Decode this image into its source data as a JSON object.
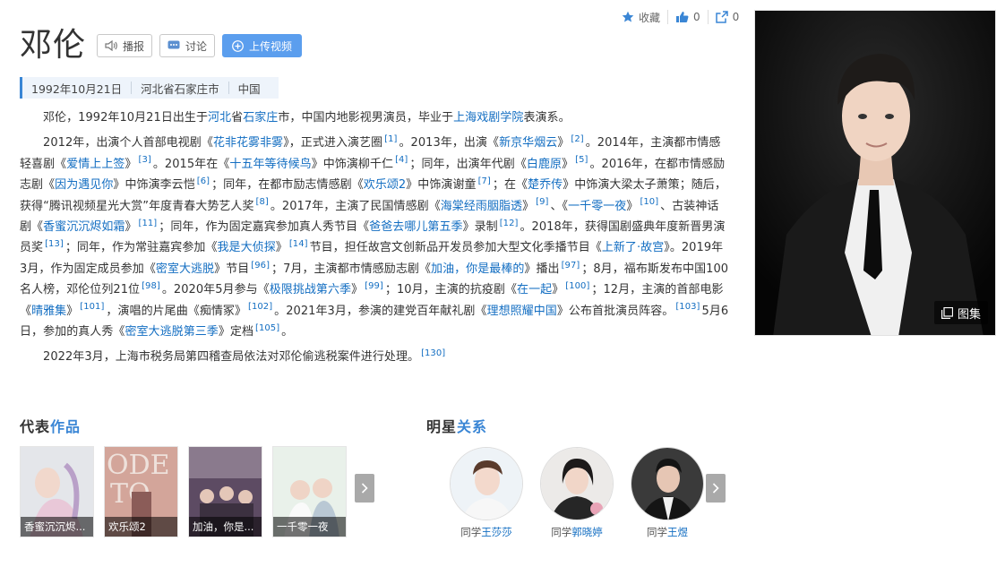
{
  "actions": {
    "collect": "收藏",
    "like_count": "0",
    "share_count": "0"
  },
  "header": {
    "name": "邓伦",
    "btn_broadcast": "播报",
    "btn_discuss": "讨论",
    "btn_upload": "上传视频"
  },
  "info": {
    "birth": "1992年10月21日",
    "birthplace": "河北省石家庄市",
    "country": "中国"
  },
  "summary": {
    "p1": {
      "t1": "邓伦，1992年10月21日出生于",
      "l1": "河北",
      "t2": "省",
      "l2": "石家庄",
      "t3": "市，中国内地影视男演员，毕业于",
      "l3": "上海戏剧学院",
      "t4": "表演系。"
    },
    "p2": {
      "t1": "2012年，出演个人首部电视剧《",
      "l1": "花非花雾非雾",
      "t2": "》，正式进入演艺圈",
      "r1": "[1]",
      "t3": "。2013年，出演《",
      "l2": "新京华烟云",
      "t4": "》",
      "r2": "[2]",
      "t5": "。2014年，主演都市情感轻喜剧《",
      "l3": "爱情上上签",
      "t6": "》",
      "r3": "[3]",
      "t7": "。2015年在《",
      "l4": "十五年等待候鸟",
      "t8": "》中饰演柳千仁",
      "r4": "[4]",
      "t9": "；同年，出演年代剧《",
      "l5": "白鹿原",
      "t10": "》",
      "r5": "[5]",
      "t11": "。2016年，在都市情感励志剧《",
      "l6": "因为遇见你",
      "t12": "》中饰演李云恺",
      "r6": "[6]",
      "t13": "；同年，在都市励志情感剧《",
      "l7": "欢乐颂2",
      "t14": "》中饰演谢童",
      "r7": "[7]",
      "t15": "；在《",
      "l8": "楚乔传",
      "t16": "》中饰演大梁太子萧策；随后，获得“腾讯视频星光大赏”年度青春大势艺人奖",
      "r8": "[8]",
      "t17": "。2017年，主演了民国情感剧《",
      "l9": "海棠经雨胭脂透",
      "t18": "》",
      "r9": "[9]",
      "t19": "、《",
      "l10": "一千零一夜",
      "t20": "》",
      "r10": "[10]",
      "t21": "、古装神话剧《",
      "l11": "香蜜沉沉烬如霜",
      "t22": "》",
      "r11": "[11]",
      "t23": "；同年，作为固定嘉宾参加真人秀节目《",
      "l12": "爸爸去哪儿第五季",
      "t24": "》录制",
      "r12": "[12]",
      "t25": "。2018年，获得国剧盛典年度新晋男演员奖",
      "r13": "[13]",
      "t26": "；同年，作为常驻嘉宾参加《",
      "l13": "我是大侦探",
      "t27": "》",
      "r14": "[14]",
      "t28": "节目，担任故宫文创新品开发员参加大型文化季播节目《",
      "l14": "上新了·故宫",
      "t29": "》。2019年3月，作为固定成员参加《",
      "l15": "密室大逃脱",
      "t30": "》节目",
      "r15": "[96]",
      "t31": "；7月，主演都市情感励志剧《",
      "l16": "加油，你是最棒的",
      "t32": "》播出",
      "r16": "[97]",
      "t33": "；8月，福布斯发布中国100名人榜，邓伦位列21位",
      "r17": "[98]",
      "t34": "。2020年5月参与《",
      "l17": "极限挑战第六季",
      "t35": "》",
      "r18": "[99]",
      "t36": "；10月，主演的抗疫剧《",
      "l18": "在一起",
      "t37": "》",
      "r19": "[100]",
      "t38": "；12月，主演的首部电影《",
      "l19": "晴雅集",
      "t39": "》",
      "r20": "[101]",
      "t40": "，演唱的片尾曲《痴情冢》",
      "r21": "[102]",
      "t41": "。2021年3月，参演的建党百年献礼剧《",
      "l20": "理想照耀中国",
      "t42": "》公布首批演员阵容。",
      "r22": "[103]",
      "t43": "5月6日，参加的真人秀《",
      "l21": "密室大逃脱第三季",
      "t44": "》定档",
      "r23": "[105]",
      "t45": "。"
    },
    "p3": {
      "t1": "2022年3月，上海市税务局第四稽查局依法对邓伦偷逃税案件进行处理。",
      "r1": "[130]"
    }
  },
  "portrait": {
    "gallery_label": "图集"
  },
  "works_section": {
    "title_a": "代表",
    "title_b": "作品",
    "items": [
      {
        "caption": "香蜜沉沉烬..."
      },
      {
        "caption": "欢乐颂2"
      },
      {
        "caption": "加油，你是..."
      },
      {
        "caption": "一千零一夜"
      }
    ]
  },
  "relations_section": {
    "title_a": "明星",
    "title_b": "关系",
    "items": [
      {
        "relation": "同学",
        "name": "王莎莎"
      },
      {
        "relation": "同学",
        "name": "郭晓婷"
      },
      {
        "relation": "同学",
        "name": "王煜"
      }
    ]
  },
  "colors": {
    "link": "#136ec2",
    "accent": "#3a86d5",
    "upload_button": "#5b9eee"
  }
}
